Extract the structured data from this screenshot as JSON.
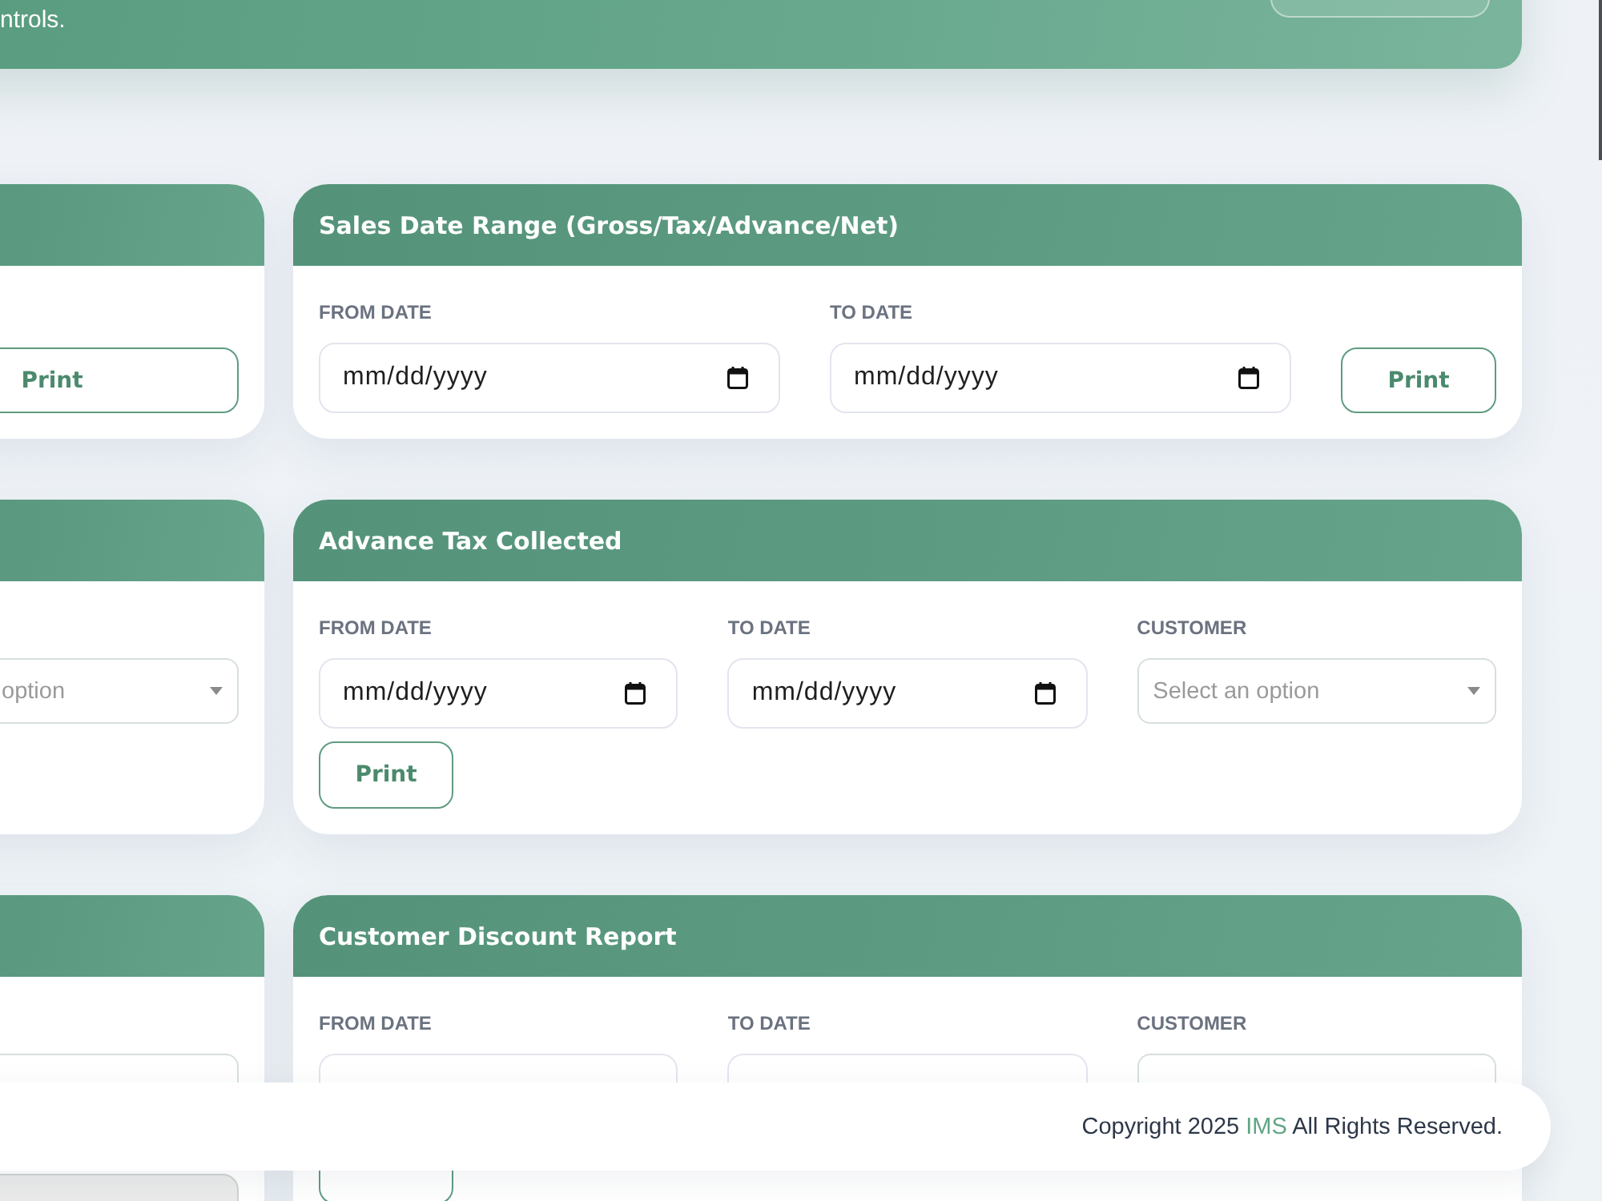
{
  "banner": {
    "subtitle": "ntrols."
  },
  "columns": [
    {
      "cards": [
        {
          "has_button": true,
          "button_label": "Print"
        },
        {
          "fields": [
            {
              "kind": "select",
              "placeholder": "option"
            }
          ]
        },
        {
          "fields": [
            {
              "kind": "select"
            },
            {
              "kind": "disabled"
            }
          ]
        }
      ]
    },
    {
      "cards": [
        {
          "title": "Sales Date Range (Gross/Tax/Advance/Net)",
          "fields": [
            {
              "kind": "date",
              "label": "FROM DATE",
              "placeholder": "mm/dd/yyyy"
            },
            {
              "kind": "date",
              "label": "TO DATE",
              "placeholder": "mm/dd/yyyy"
            }
          ],
          "has_button": true,
          "button_label": "Print"
        },
        {
          "title": "Advance Tax Collected",
          "fields": [
            {
              "kind": "date",
              "label": "FROM DATE",
              "placeholder": "mm/dd/yyyy"
            },
            {
              "kind": "date",
              "label": "TO DATE",
              "placeholder": "mm/dd/yyyy"
            },
            {
              "kind": "select",
              "label": "CUSTOMER",
              "placeholder": "Select an option"
            }
          ],
          "has_button": true,
          "button_label": "Print"
        },
        {
          "title": "Customer Discount Report",
          "fields": [
            {
              "kind": "date",
              "label": "FROM DATE"
            },
            {
              "kind": "date",
              "label": "TO DATE"
            },
            {
              "kind": "select",
              "label": "CUSTOMER"
            }
          ],
          "has_button": true
        }
      ]
    }
  ],
  "footer": {
    "text_before": "Copyright 2025",
    "link": "IMS",
    "text_after": "All Rights Reserved."
  }
}
